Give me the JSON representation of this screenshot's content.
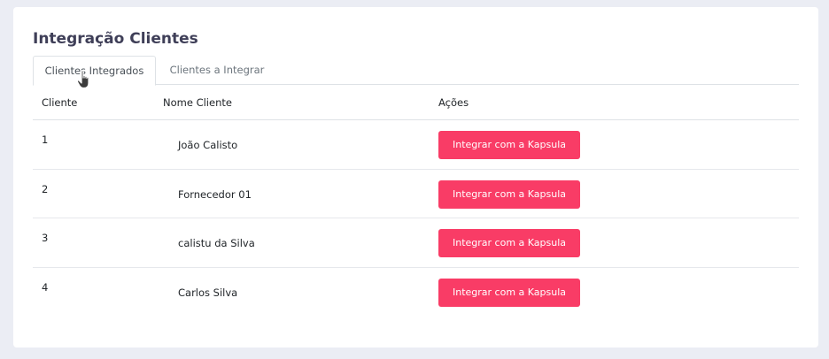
{
  "page": {
    "title": "Integração Clientes"
  },
  "tabs": [
    {
      "label": "Clientes Integrados",
      "active": true
    },
    {
      "label": "Clientes a Integrar",
      "active": false
    }
  ],
  "table": {
    "headers": {
      "cliente": "Cliente",
      "nome": "Nome Cliente",
      "acoes": "Ações"
    },
    "rows": [
      {
        "id": "1",
        "name": "João Calisto",
        "action": "Integrar com a Kapsula"
      },
      {
        "id": "2",
        "name": "Fornecedor 01",
        "action": "Integrar com a Kapsula"
      },
      {
        "id": "3",
        "name": "calistu da Silva",
        "action": "Integrar com a Kapsula"
      },
      {
        "id": "4",
        "name": "Carlos Silva",
        "action": "Integrar com a Kapsula"
      }
    ]
  },
  "colors": {
    "button": "#f93c66",
    "background": "#ebedf4",
    "title": "#3f3f58"
  }
}
